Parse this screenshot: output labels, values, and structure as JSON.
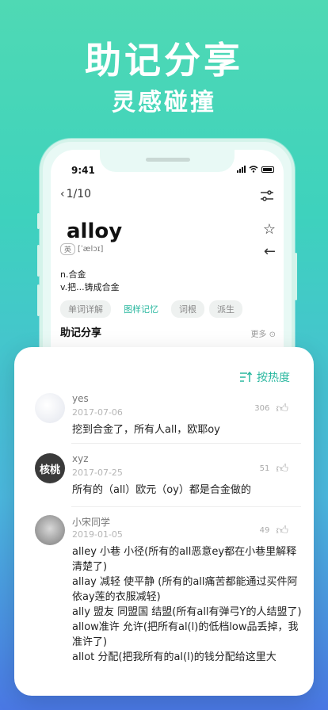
{
  "hero": {
    "title": "助记分享",
    "subtitle": "灵感碰撞"
  },
  "status": {
    "time": "9:41"
  },
  "nav": {
    "back_label": "1/10"
  },
  "word": {
    "text": "alloy",
    "accent_tag": "英",
    "phonetic": "[ˈælɔɪ]",
    "definitions": [
      "n.合金",
      "v.把...铸成合金"
    ]
  },
  "tabs": [
    {
      "label": "单词详解",
      "active": false
    },
    {
      "label": "图样记忆",
      "active": true
    },
    {
      "label": "词根",
      "active": false
    },
    {
      "label": "派生",
      "active": false
    }
  ],
  "section": {
    "title": "助记分享",
    "more": "更多"
  },
  "sort": {
    "label": "按热度"
  },
  "comments": [
    {
      "user": "yes",
      "date": "2017-07-06",
      "likes": "306",
      "text": "挖到合金了，所有人all，欧耶oy"
    },
    {
      "user": "xyz",
      "date": "2017-07-25",
      "likes": "51",
      "avatar_text": "核桃",
      "text": "所有的（all）欧元（oy）都是合金做的"
    },
    {
      "user": "小宋同学",
      "date": "2019-01-05",
      "likes": "49",
      "text": "alley 小巷 小径(所有的all恶意ey都在小巷里解释清楚了)\nallay 减轻 使平静 (所有的all痛苦都能通过买件阿依ay莲的衣服减轻)\nally 盟友 同盟国 结盟(所有all有弹弓Y的人结盟了)\nallow准许 允许(把所有al(l)的低档low品丢掉，我准许了)\nallot 分配(把我所有的al(l)的钱分配给这里大"
    }
  ],
  "colors": {
    "accent": "#2bb8a0",
    "bg_top": "#4fd9b4",
    "bg_bottom": "#4a78e4"
  }
}
